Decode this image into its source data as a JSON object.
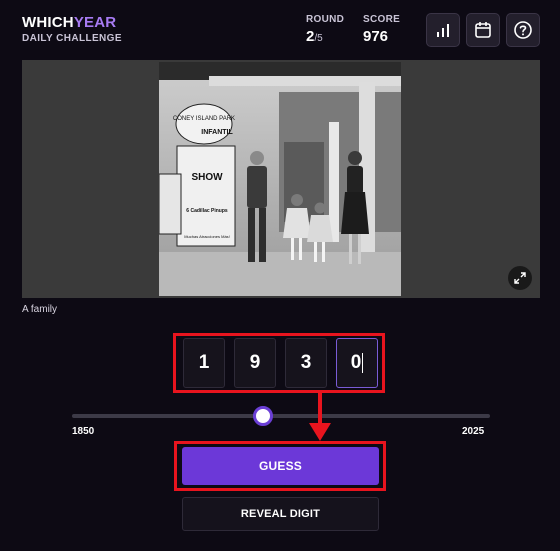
{
  "header": {
    "logo_primary": "WHICH",
    "logo_accent": "YEAR",
    "subtitle": "DAILY CHALLENGE",
    "round_label": "ROUND",
    "round_current": "2",
    "round_total": "/5",
    "score_label": "SCORE",
    "score_value": "976",
    "icons": [
      "stats-icon",
      "calendar-icon",
      "help-icon"
    ]
  },
  "photo": {
    "caption": "A family",
    "sign_lines": [
      "CONEY ISLAND PARK",
      "INFANTIL",
      "SHOW",
      "6 Cadillac Pinups",
      "Muchas Atracciones Más!"
    ],
    "expand_icon": "expand-icon"
  },
  "guess": {
    "digits": [
      "1",
      "9",
      "3",
      "0"
    ],
    "active_digit_index": 3
  },
  "slider": {
    "min_label": "1850",
    "max_label": "2025",
    "min": 1850,
    "max": 2025,
    "value": 1930
  },
  "buttons": {
    "guess_label": "GUESS",
    "reveal_label": "REVEAL DIGIT"
  },
  "colors": {
    "background": "#0d0a14",
    "accent": "#a77bf3",
    "primary_button": "#6c38d8",
    "annotation": "#e8141e"
  }
}
